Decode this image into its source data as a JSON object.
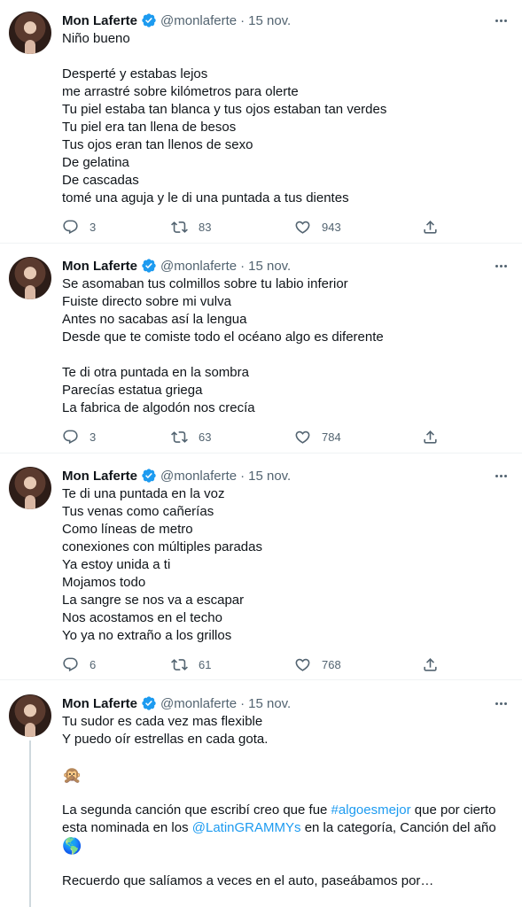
{
  "author": {
    "name": "Mon Laferte",
    "handle": "@monlaferte",
    "separator": "·"
  },
  "tweets": [
    {
      "date": "15 nov.",
      "lines": [
        "Niño bueno",
        "",
        "Desperté y estabas lejos",
        "me arrastré sobre kilómetros para olerte",
        "Tu piel estaba tan blanca y tus ojos estaban tan verdes",
        "Tu piel era tan llena de besos",
        "Tus ojos eran tan llenos de sexo",
        "De gelatina",
        "De cascadas",
        "tomé una aguja y le di una puntada a tus dientes"
      ],
      "replies": "3",
      "retweets": "83",
      "likes": "943"
    },
    {
      "date": "15 nov.",
      "lines": [
        "Se asomaban tus colmillos sobre tu labio inferior",
        "Fuiste directo sobre mi vulva",
        "Antes no sacabas así la lengua",
        "Desde que te comiste todo el océano algo es diferente",
        "",
        "Te di otra puntada en la sombra",
        "Parecías estatua griega",
        "La fabrica de algodón nos crecía"
      ],
      "replies": "3",
      "retweets": "63",
      "likes": "784"
    },
    {
      "date": "15 nov.",
      "lines": [
        "Te di una puntada en la voz",
        "Tus venas como cañerías",
        "Como líneas de metro",
        "conexiones con múltiples paradas",
        "Ya estoy unida a ti",
        "Mojamos todo",
        "La sangre se nos va a escapar",
        "Nos acostamos en el techo",
        "Yo ya no extraño a los grillos"
      ],
      "replies": "6",
      "retweets": "61",
      "likes": "768"
    },
    {
      "date": "15 nov.",
      "lines": [
        "Tu sudor es cada vez mas flexible",
        "Y puedo oír estrellas en cada gota."
      ],
      "emoji_monkey": "🙊",
      "para_before_hashtag": "La segunda canción que escribí creo que fue ",
      "hashtag": "#algoesmejor",
      "para_mid": " que por cierto esta nominada en los ",
      "mention": "@LatinGRAMMYs",
      "para_after": " en la categoría, Canción del año",
      "emoji_globe": "🌎",
      "last_line": "Recuerdo que salíamos a veces en el auto, paseábamos por…"
    }
  ],
  "colors": {
    "text": "#0f1419",
    "secondary": "#536471",
    "link": "#1d9bf0",
    "verified": "#1d9bf0",
    "divider": "#eff3f4",
    "thread_line": "#cfd9de"
  },
  "icons": [
    "verified-badge-icon",
    "more-options-icon",
    "reply-icon",
    "retweet-icon",
    "like-icon",
    "share-icon"
  ]
}
